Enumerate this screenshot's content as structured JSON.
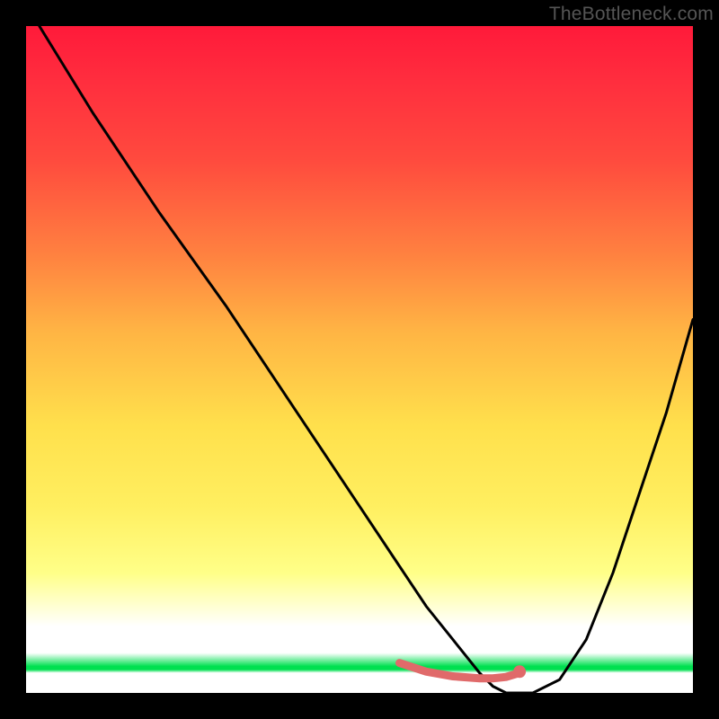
{
  "attribution": "TheBottleneck.com",
  "chart_data": {
    "type": "line",
    "title": "",
    "xlabel": "",
    "ylabel": "",
    "xlim": [
      0,
      100
    ],
    "ylim": [
      0,
      100
    ],
    "grid": false,
    "series": [
      {
        "name": "main-curve",
        "color": "#000000",
        "x": [
          2,
          10,
          20,
          30,
          40,
          50,
          56,
          60,
          64,
          68,
          70,
          72,
          76,
          80,
          84,
          88,
          92,
          96,
          100
        ],
        "y": [
          100,
          87,
          72,
          58,
          43,
          28,
          19,
          13,
          8,
          3,
          1,
          0,
          0,
          2,
          8,
          18,
          30,
          42,
          56
        ]
      },
      {
        "name": "marker-segment",
        "color": "#e06a6a",
        "x": [
          56,
          60,
          64,
          68,
          70,
          72,
          74
        ],
        "y": [
          4.5,
          3.2,
          2.5,
          2.2,
          2.2,
          2.4,
          3.0
        ]
      }
    ],
    "markers": [
      {
        "name": "marker-dot",
        "x": 74,
        "y": 3.2,
        "r": 1.0,
        "color": "#e06a6a"
      }
    ]
  }
}
